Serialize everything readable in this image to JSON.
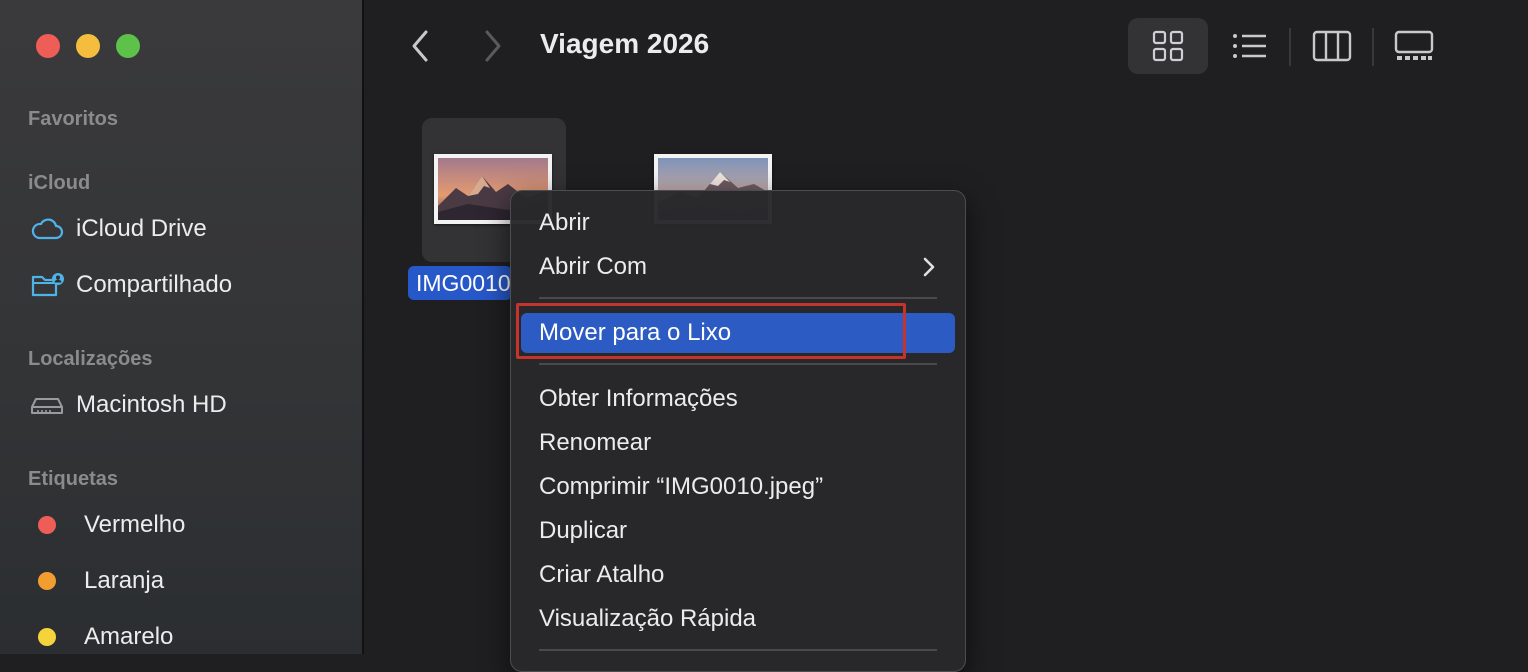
{
  "window": {
    "title": "Viagem 2026"
  },
  "sidebar": {
    "sections": [
      {
        "title": "Favoritos",
        "items": []
      },
      {
        "title": "iCloud",
        "items": [
          {
            "label": "iCloud Drive",
            "icon": "cloud-icon"
          },
          {
            "label": "Compartilhado",
            "icon": "shared-folder-icon"
          }
        ]
      },
      {
        "title": "Localizações",
        "items": [
          {
            "label": "Macintosh HD",
            "icon": "disk-icon"
          }
        ]
      },
      {
        "title": "Etiquetas",
        "items": [
          {
            "label": "Vermelho",
            "color": "#ee5e57"
          },
          {
            "label": "Laranja",
            "color": "#f29d2f"
          },
          {
            "label": "Amarelo",
            "color": "#f4d43a"
          }
        ]
      }
    ]
  },
  "files": [
    {
      "name": "IMG0010",
      "selected": true
    },
    {
      "name": "",
      "selected": false
    }
  ],
  "context_menu": {
    "items": [
      {
        "label": "Abrir"
      },
      {
        "label": "Abrir Com",
        "submenu": true
      },
      {
        "label": "Mover para o Lixo",
        "highlighted": true
      },
      {
        "label": "Obter Informações"
      },
      {
        "label": "Renomear"
      },
      {
        "label": "Comprimir “IMG0010.jpeg”"
      },
      {
        "label": "Duplicar"
      },
      {
        "label": "Criar Atalho"
      },
      {
        "label": "Visualização Rápida"
      }
    ]
  },
  "colors": {
    "accent": "#2d5bc4",
    "annotation": "#c4342c"
  }
}
